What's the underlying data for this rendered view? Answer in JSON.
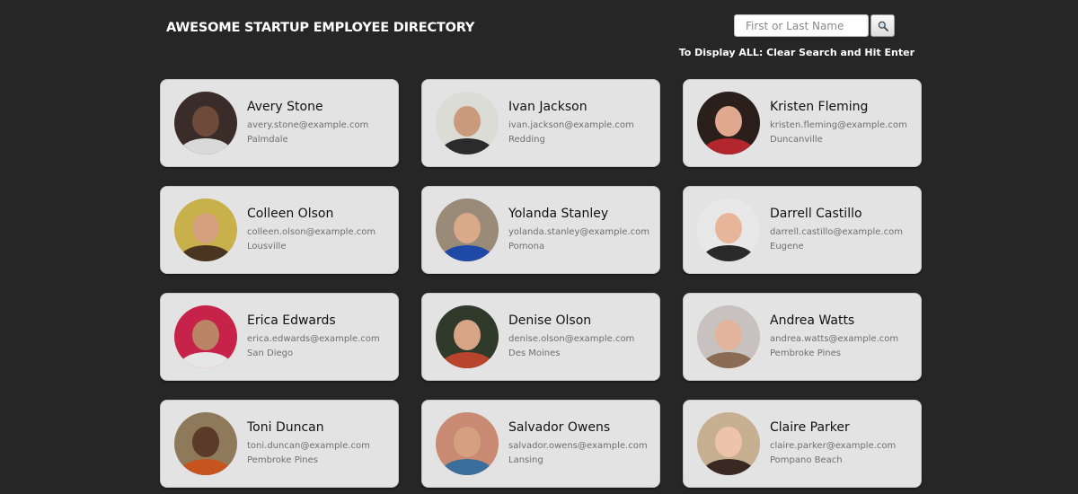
{
  "header": {
    "title": "AWESOME STARTUP EMPLOYEE DIRECTORY"
  },
  "search": {
    "placeholder": "First or Last Name",
    "value": "",
    "button_icon": "search-icon",
    "hint": "To Display ALL: Clear Search and Hit Enter"
  },
  "employees": [
    {
      "name": "Avery Stone",
      "email": "avery.stone@example.com",
      "city": "Palmdale",
      "avatar_bg": "#3a2c28",
      "avatar_face": "#6e4a3a",
      "avatar_body": "#d9d9d9"
    },
    {
      "name": "Ivan Jackson",
      "email": "ivan.jackson@example.com",
      "city": "Redding",
      "avatar_bg": "#dcdcd6",
      "avatar_face": "#c99a7c",
      "avatar_body": "#2b2b2b"
    },
    {
      "name": "Kristen Fleming",
      "email": "kristen.fleming@example.com",
      "city": "Duncanville",
      "avatar_bg": "#2b1f1c",
      "avatar_face": "#e0a88f",
      "avatar_body": "#b3262e"
    },
    {
      "name": "Colleen Olson",
      "email": "colleen.olson@example.com",
      "city": "Lousville",
      "avatar_bg": "#c8b14a",
      "avatar_face": "#d4a07e",
      "avatar_body": "#4a3520"
    },
    {
      "name": "Yolanda Stanley",
      "email": "yolanda.stanley@example.com",
      "city": "Pomona",
      "avatar_bg": "#9a8a78",
      "avatar_face": "#d9a98a",
      "avatar_body": "#1f49a6"
    },
    {
      "name": "Darrell Castillo",
      "email": "darrell.castillo@example.com",
      "city": "Eugene",
      "avatar_bg": "#e8e8e8",
      "avatar_face": "#e6b59a",
      "avatar_body": "#2a2a2a"
    },
    {
      "name": "Erica Edwards",
      "email": "erica.edwards@example.com",
      "city": "San Diego",
      "avatar_bg": "#c7234a",
      "avatar_face": "#b98566",
      "avatar_body": "#e6e6e6"
    },
    {
      "name": "Denise Olson",
      "email": "denise.olson@example.com",
      "city": "Des Moines",
      "avatar_bg": "#2f3a2a",
      "avatar_face": "#d7a585",
      "avatar_body": "#b8442d"
    },
    {
      "name": "Andrea Watts",
      "email": "andrea.watts@example.com",
      "city": "Pembroke Pines",
      "avatar_bg": "#c7c2bf",
      "avatar_face": "#e2b49b",
      "avatar_body": "#8c6b55"
    },
    {
      "name": "Toni Duncan",
      "email": "toni.duncan@example.com",
      "city": "Pembroke Pines",
      "avatar_bg": "#8e7a5a",
      "avatar_face": "#5a3a28",
      "avatar_body": "#c5541e"
    },
    {
      "name": "Salvador Owens",
      "email": "salvador.owens@example.com",
      "city": "Lansing",
      "avatar_bg": "#c98a73",
      "avatar_face": "#d4a080",
      "avatar_body": "#3b6e9a"
    },
    {
      "name": "Claire Parker",
      "email": "claire.parker@example.com",
      "city": "Pompano Beach",
      "avatar_bg": "#c7b091",
      "avatar_face": "#ecc4aa",
      "avatar_body": "#3a2822"
    }
  ]
}
